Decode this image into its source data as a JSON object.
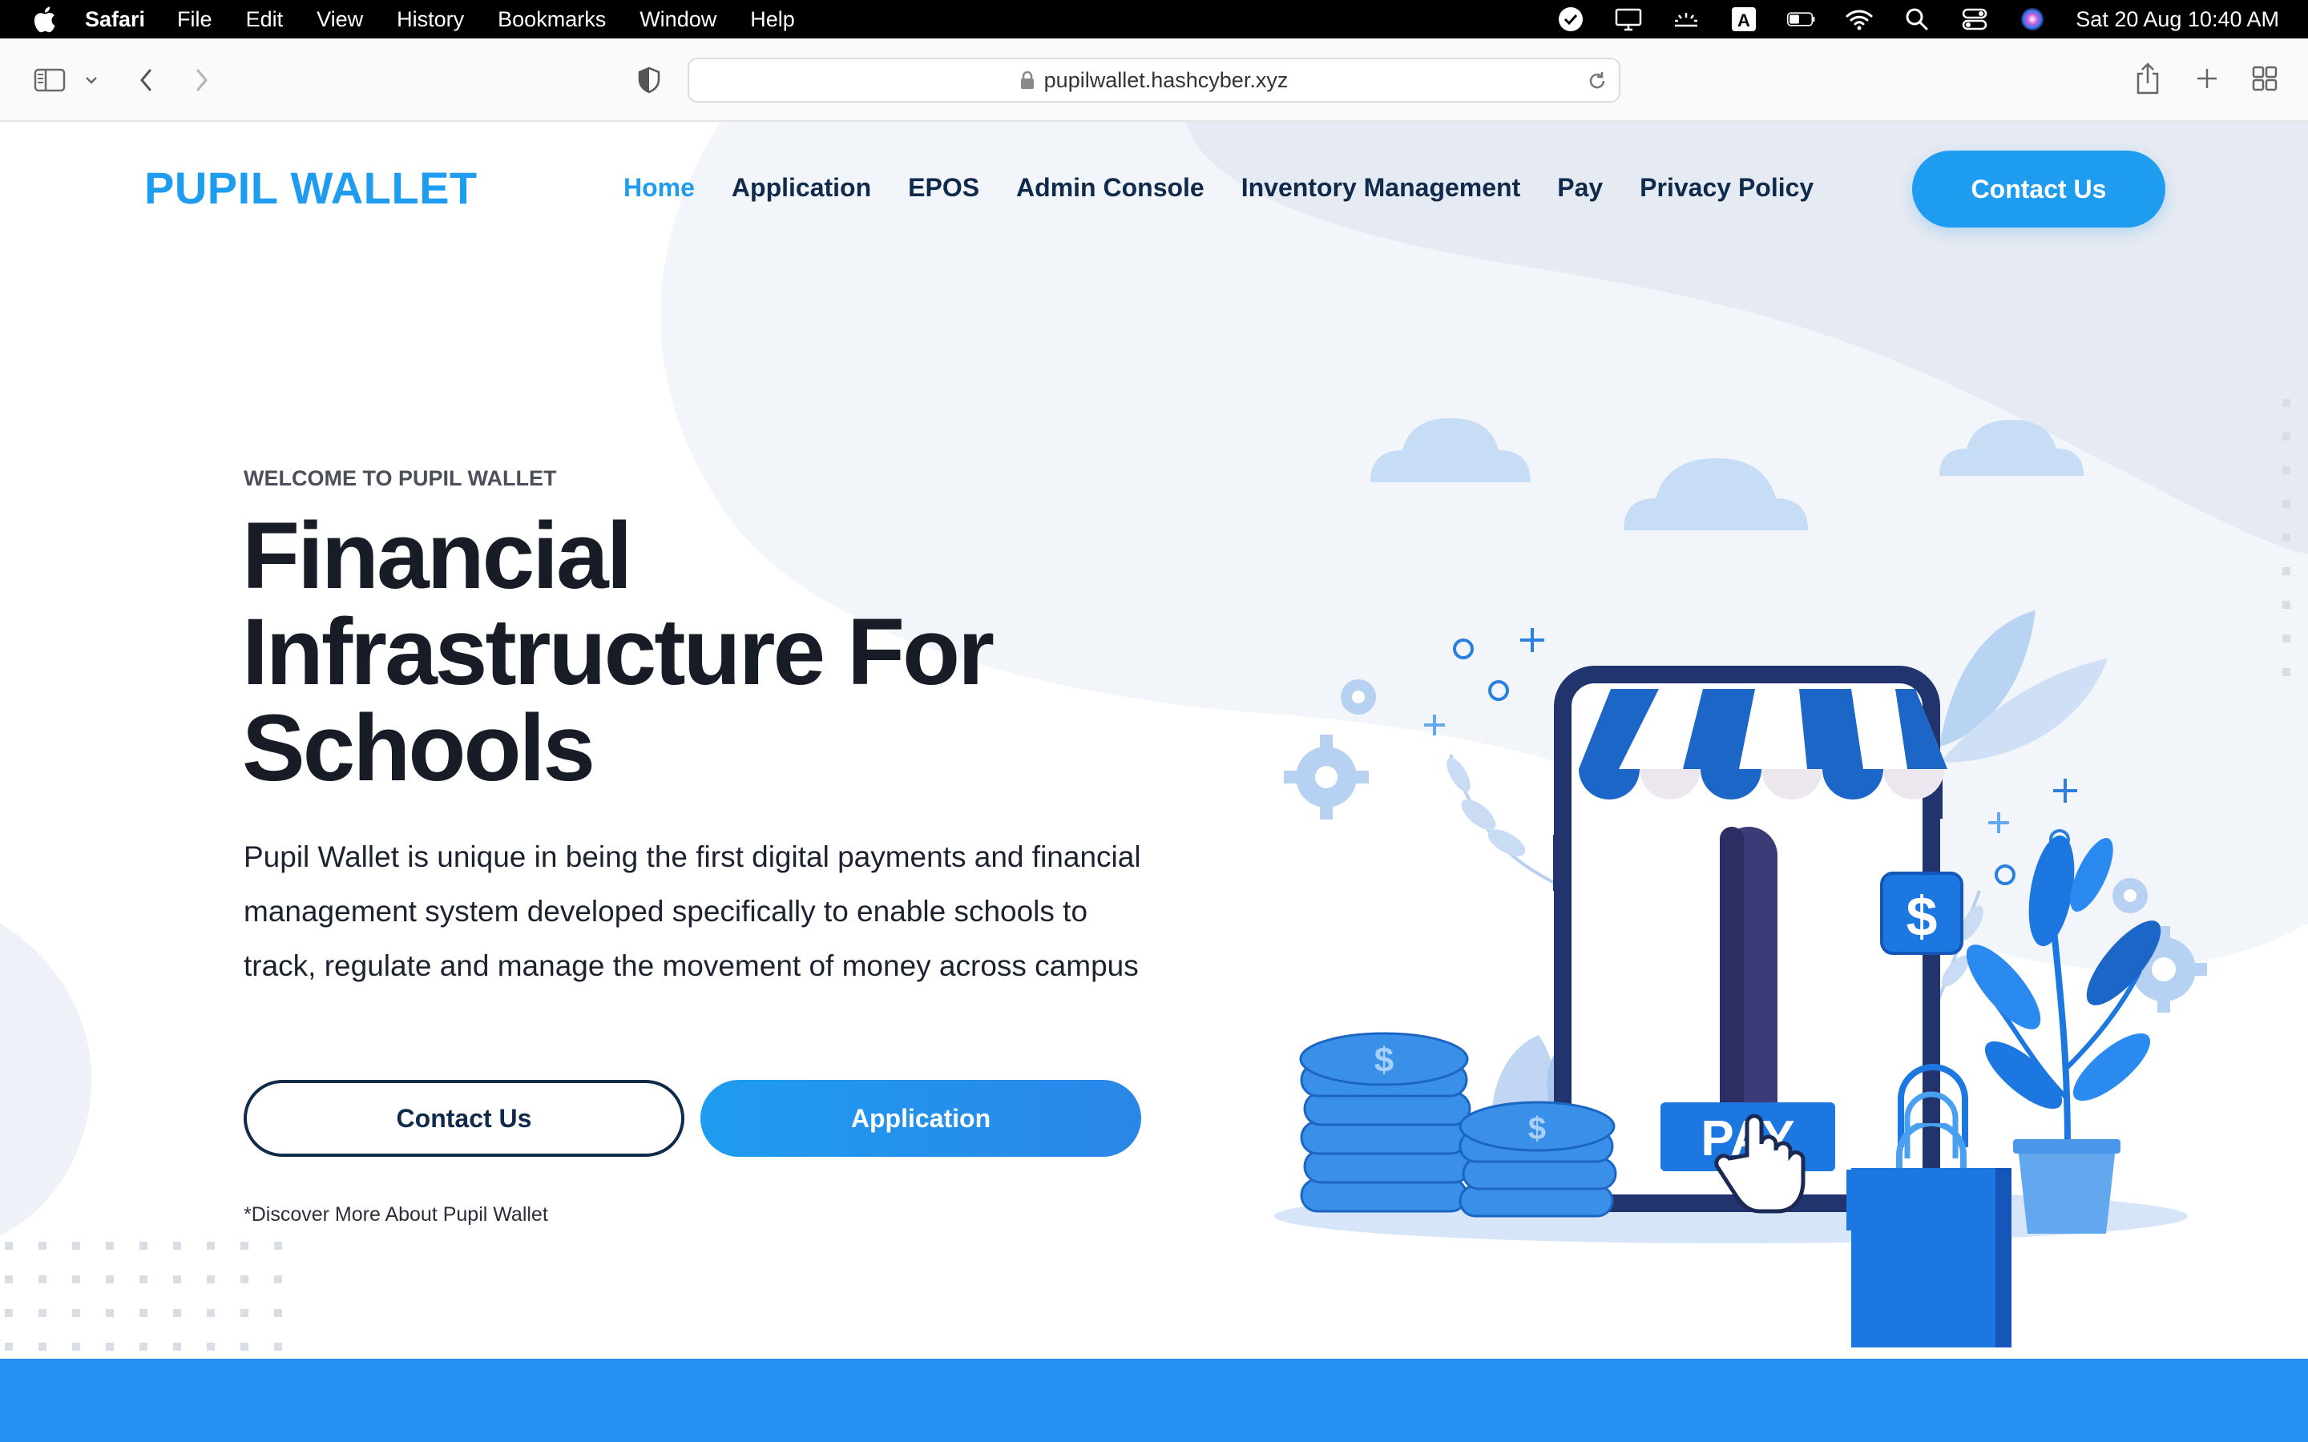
{
  "menubar": {
    "app_name": "Safari",
    "items": [
      "File",
      "Edit",
      "View",
      "History",
      "Bookmarks",
      "Window",
      "Help"
    ],
    "clock": "Sat 20 Aug  10:40 AM"
  },
  "browser": {
    "url": "pupilwallet.hashcyber.xyz"
  },
  "site": {
    "logo": "PUPIL WALLET",
    "nav": [
      "Home",
      "Application",
      "EPOS",
      "Admin Console",
      "Inventory Management",
      "Pay",
      "Privacy Policy"
    ],
    "nav_cta": "Contact Us"
  },
  "hero": {
    "eyebrow": "WELCOME TO PUPIL WALLET",
    "headline_line1": "Financial",
    "headline_line2": "Infrastructure For",
    "headline_line3": "Schools",
    "description": "Pupil Wallet is unique in being the first digital payments and financial management system developed specifically to enable schools to track, regulate and manage the movement of money across campus",
    "primary_button": "Contact Us",
    "secondary_button": "Application",
    "discover_link": "*Discover More About Pupil Wallet"
  },
  "illustration": {
    "pay_label": "PAY",
    "currency_symbol": "$"
  },
  "colors": {
    "brand_blue": "#1e9cf0",
    "navy": "#0f2a4a",
    "band_blue": "#2490f0"
  }
}
